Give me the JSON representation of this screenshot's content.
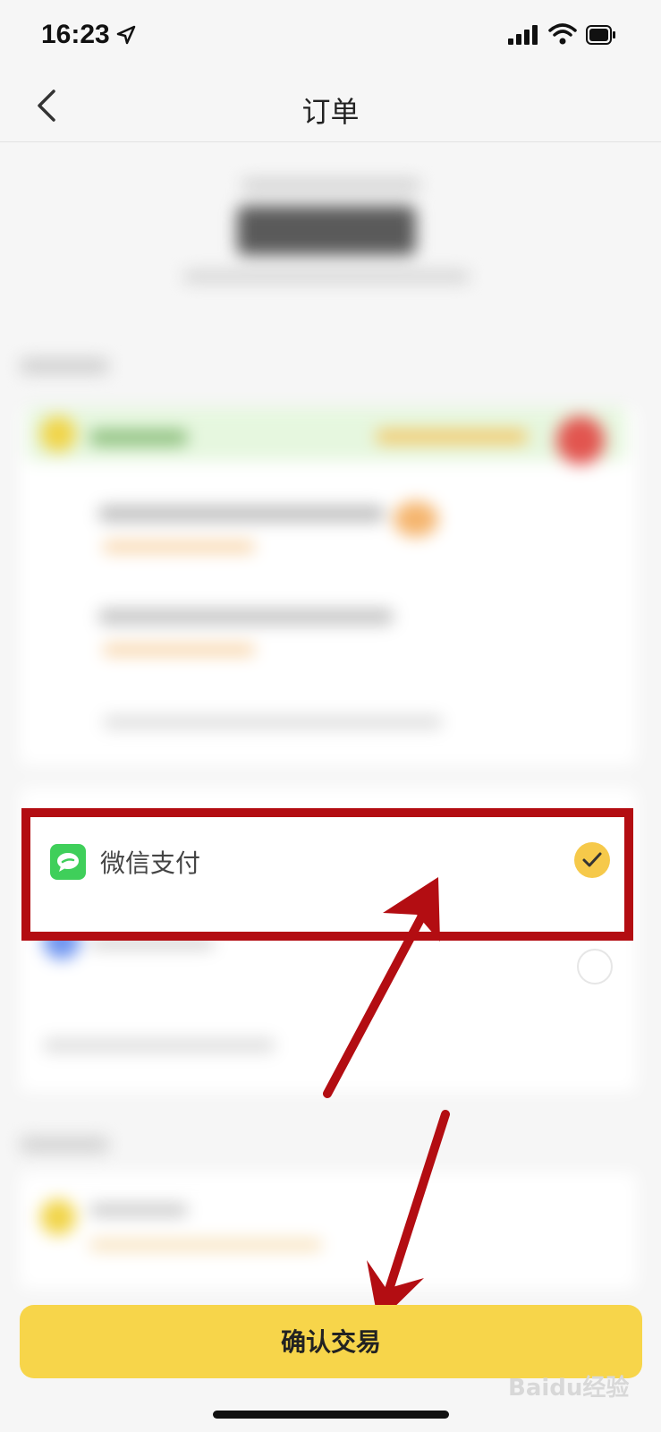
{
  "status_bar": {
    "time": "16:23"
  },
  "nav": {
    "title": "订单"
  },
  "payment": {
    "wechat_label": "微信支付"
  },
  "footer": {
    "confirm_label": "确认交易"
  },
  "watermark": {
    "text": "Baidu经验"
  },
  "colors": {
    "accent": "#f7d54a",
    "check": "#f6c94a",
    "annotation": "#b30d12",
    "wechat": "#3fcf5a"
  }
}
